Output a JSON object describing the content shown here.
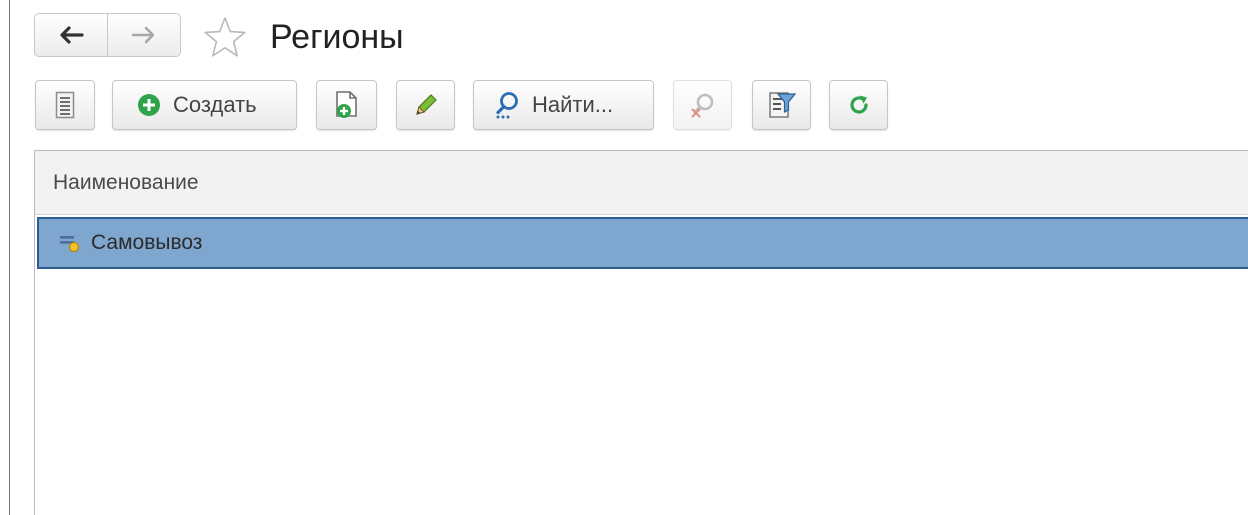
{
  "header": {
    "title": "Регионы"
  },
  "toolbar": {
    "create_label": "Создать",
    "find_label": "Найти..."
  },
  "table": {
    "columns": [
      "Наименование"
    ],
    "rows": [
      {
        "name": "Самовывоз",
        "icon": "predefined-item-icon",
        "selected": true
      }
    ]
  },
  "colors": {
    "selection_fill": "#7ea6cf",
    "selection_border": "#2c5c92",
    "create_green": "#2fa34a",
    "refresh_green": "#2fa34a"
  }
}
